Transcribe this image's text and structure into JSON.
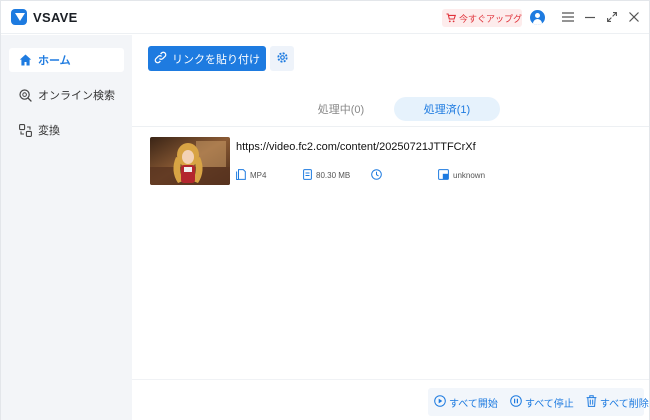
{
  "app": {
    "name": "VSAVE",
    "upgrade_label": "今すぐアップグレード",
    "accent": "#1e7be0"
  },
  "sidebar": {
    "items": [
      {
        "label": "ホーム",
        "icon": "home-icon",
        "active": true
      },
      {
        "label": "オンライン検索",
        "icon": "search-icon",
        "active": false
      },
      {
        "label": "変換",
        "icon": "convert-icon",
        "active": false
      }
    ]
  },
  "toolbar": {
    "paste_label": "リンクを貼り付け"
  },
  "tabs": [
    {
      "label": "処理中(0)",
      "active": false
    },
    {
      "label": "処理済(1)",
      "active": true
    }
  ],
  "items": [
    {
      "url": "https://video.fc2.com/content/20250721JTTFCrXf",
      "format": "MP4",
      "size": "80.30 MB",
      "duration": "",
      "resolution": "unknown"
    }
  ],
  "footer": {
    "start_all": "すべて開始",
    "stop_all": "すべて停止",
    "delete_all": "すべて削除"
  }
}
